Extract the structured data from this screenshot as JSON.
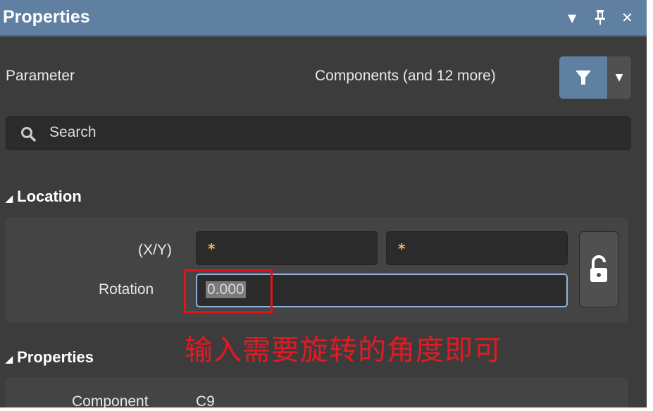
{
  "header": {
    "title": "Properties"
  },
  "toolbar": {
    "parameter_label": "Parameter",
    "filter_label": "Components (and 12 more)"
  },
  "search": {
    "placeholder": "Search"
  },
  "location": {
    "title": "Location",
    "xy_label": "(X/Y)",
    "x_value": "*",
    "y_value": "*",
    "rotation_label": "Rotation",
    "rotation_value": "0.000"
  },
  "annotation": {
    "text": "输入需要旋转的角度即可",
    "color": "#e21a22"
  },
  "properties": {
    "title": "Properties",
    "component_label": "Component",
    "component_value": "C9"
  },
  "colors": {
    "titlebar": "#5f80a0",
    "background": "#3c3c3c"
  }
}
